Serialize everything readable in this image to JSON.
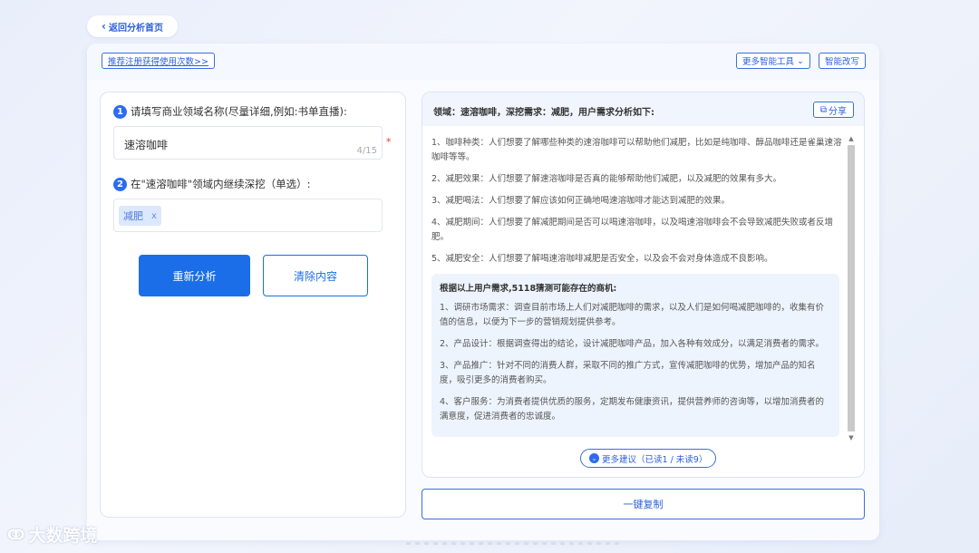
{
  "nav": {
    "back_label": "返回分析首页",
    "back_icon": "chevron-left-icon"
  },
  "toolbar": {
    "promo_link": "推荐注册获得使用次数>>",
    "more_tools": "更多智能工具",
    "smart_rewrite": "智能改写"
  },
  "form": {
    "step1_num": "1",
    "step1_label": "请填写商业领域名称(尽量详细,例如:书单直播):",
    "domain_value": "速溶咖啡",
    "char_count": "4/15",
    "required_mark": "*",
    "step2_num": "2",
    "step2_label": "在\"速溶咖啡\"领域内继续深挖（单选）:",
    "selected_tag": "减肥",
    "tag_remove": "x",
    "reanalyze": "重新分析",
    "clear": "清除内容"
  },
  "result": {
    "header": "领域：速溶咖啡，深挖需求：减肥，用户需求分析如下:",
    "share": "分享",
    "needs": [
      "1、咖啡种类：人们想要了解哪些种类的速溶咖啡可以帮助他们减肥，比如是纯咖啡、醇品咖啡还是雀巢速溶咖啡等等。",
      "2、减肥效果：人们想要了解速溶咖啡是否真的能够帮助他们减肥，以及减肥的效果有多大。",
      "3、减肥喝法：人们想要了解应该如何正确地喝速溶咖啡才能达到减肥的效果。",
      "4、减肥期间：人们想要了解减肥期间是否可以喝速溶咖啡，以及喝速溶咖啡会不会导致减肥失败或者反增肥。",
      "5、减肥安全：人们想要了解喝速溶咖啡减肥是否安全，以及会不会对身体造成不良影响。"
    ],
    "biz_title": "根据以上用户需求,5118猜测可能存在的商机:",
    "biz_items": [
      "1、调研市场需求：调查目前市场上人们对减肥咖啡的需求，以及人们是如何喝减肥咖啡的，收集有价值的信息，以便为下一步的营销规划提供参考。",
      "2、产品设计：根据调查得出的结论，设计减肥咖啡产品，加入各种有效成分，以满足消费者的需求。",
      "3、产品推广：针对不同的消费人群，采取不同的推广方式，宣传减肥咖啡的优势，增加产品的知名度，吸引更多的消费者购买。",
      "4、客户服务：为消费者提供优质的服务，定期发布健康资讯，提供营养师的咨询等，以增加消费者的满意度，促进消费者的忠诚度。"
    ],
    "more_label": "更多建议（已读1 / 未读9）",
    "copy_label": "一键复制"
  },
  "watermark": "大数跨境",
  "colors": {
    "accent": "#1b6ee8",
    "link": "#2b5fd9"
  }
}
